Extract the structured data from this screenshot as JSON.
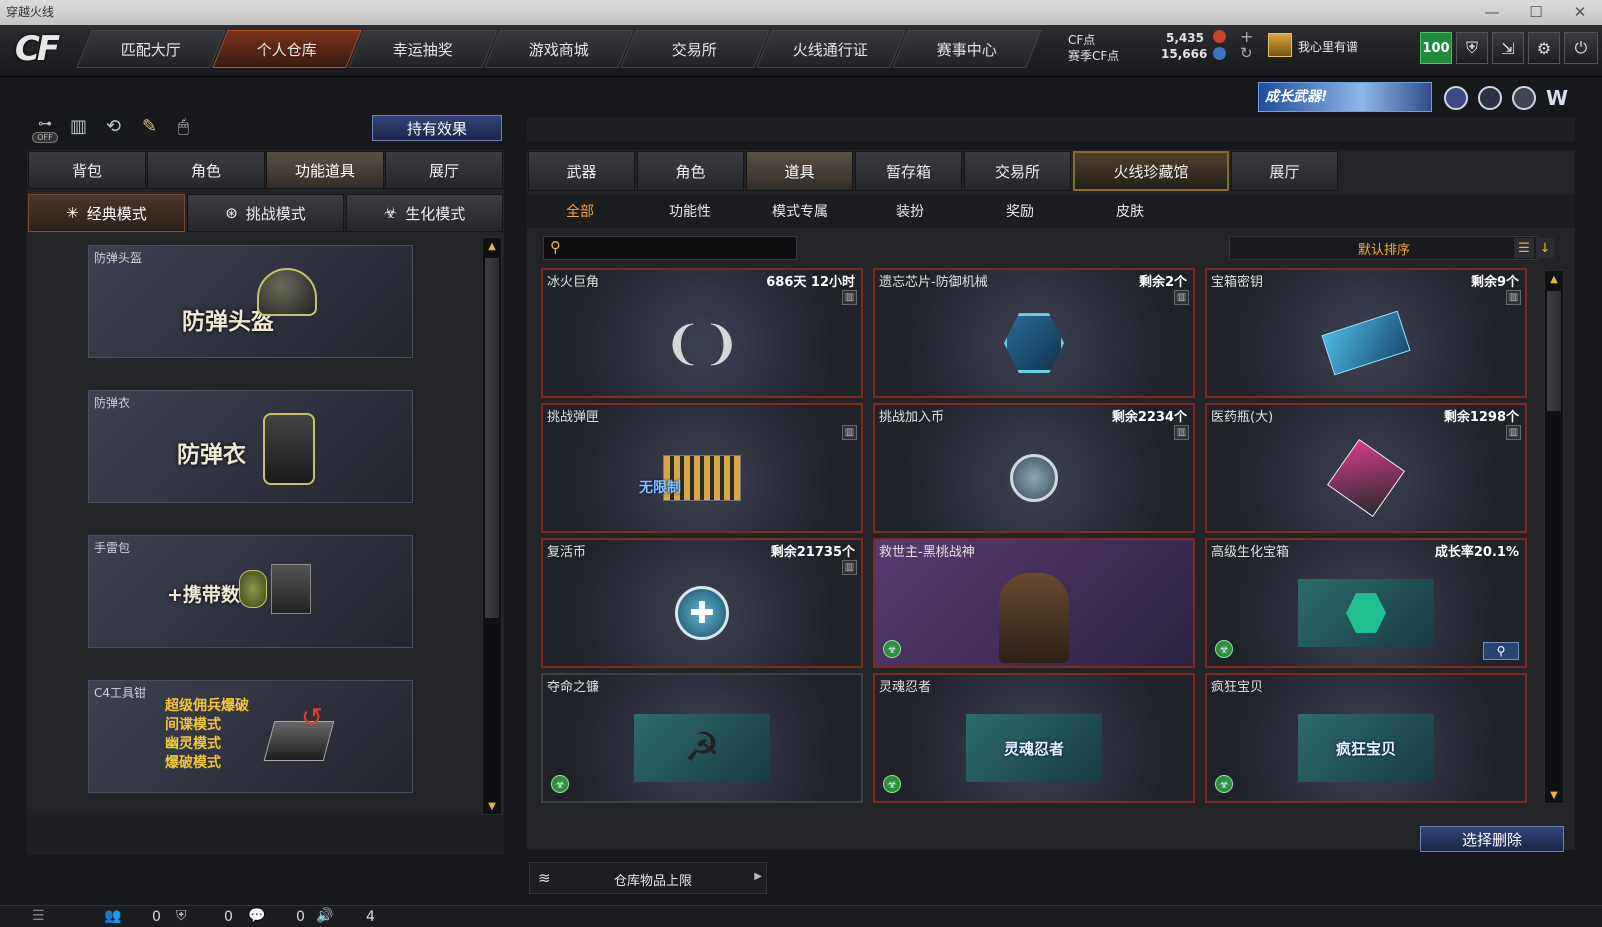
{
  "window": {
    "title": "穿越火线",
    "controls": [
      "—",
      "☐",
      "✕"
    ]
  },
  "logo": "CF",
  "nav": {
    "tabs": [
      "匹配大厅",
      "个人仓库",
      "幸运抽奖",
      "游戏商城",
      "交易所",
      "火线通行证",
      "赛事中心"
    ],
    "active": "个人仓库"
  },
  "currency": {
    "cf_label": "CF点",
    "cf_value": "5,435",
    "season_label": "赛季CF点",
    "season_value": "15,666",
    "plus": "+",
    "refresh": "↻"
  },
  "player": {
    "name": "我心里有谱",
    "level": "100"
  },
  "top_icons": [
    "shield-icon",
    "exit-icon",
    "gear-icon",
    "power-icon"
  ],
  "banner": {
    "text": "成长武器!",
    "icons": [
      "emblem-icon-1",
      "emblem-icon-2",
      "emblem-icon-3",
      "emblem-icon-4"
    ]
  },
  "left": {
    "toggle_off": "OFF",
    "effects_button": "持有效果",
    "tabs": [
      "背包",
      "角色",
      "功能道具",
      "展厅"
    ],
    "active_tab": "功能道具",
    "modes": [
      "经典模式",
      "挑战模式",
      "生化模式"
    ],
    "active_mode": "经典模式",
    "items": [
      {
        "caption": "防弹头盔",
        "big": "防弹头盔"
      },
      {
        "caption": "防弹衣",
        "big": "防弹衣"
      },
      {
        "caption": "手雷包",
        "big": "+携带数"
      },
      {
        "caption": "C4工具钳",
        "lines": [
          "超级佣兵爆破",
          "间谍模式",
          "幽灵模式",
          "爆破模式"
        ]
      }
    ]
  },
  "right": {
    "tabs": [
      "武器",
      "角色",
      "道具",
      "暂存箱",
      "交易所",
      "火线珍藏馆",
      "展厅"
    ],
    "active_tab": "道具",
    "highlight_tab": "火线珍藏馆",
    "filters": [
      "全部",
      "功能性",
      "模式专属",
      "装扮",
      "奖励",
      "皮肤"
    ],
    "active_filter": "全部",
    "search_placeholder": "",
    "sort_label": "默认排序",
    "cards": [
      {
        "name": "冰火巨角",
        "info": "686天 12小时",
        "trash": true,
        "badge": false,
        "img": "horns"
      },
      {
        "name": "遗忘芯片-防御机械",
        "info": "剩余2个",
        "trash": true,
        "badge": false,
        "img": "chip"
      },
      {
        "name": "宝箱密钥",
        "info": "剩余9个",
        "trash": true,
        "badge": false,
        "img": "key"
      },
      {
        "name": "挑战弹匣",
        "info": "",
        "trash": true,
        "badge": false,
        "img": "ammo",
        "overlay": "无限制"
      },
      {
        "name": "挑战加入币",
        "info": "剩余2234个",
        "trash": true,
        "badge": false,
        "img": "coin"
      },
      {
        "name": "医药瓶(大)",
        "info": "剩余1298个",
        "trash": true,
        "badge": false,
        "img": "medkit"
      },
      {
        "name": "复活币",
        "info": "剩余21735个",
        "trash": true,
        "badge": false,
        "img": "revive"
      },
      {
        "name": "救世主-黑桃战神",
        "info": "",
        "trash": false,
        "badge": true,
        "img": "soldier"
      },
      {
        "name": "高级生化宝箱",
        "info": "成长率20.1%",
        "trash": false,
        "badge": true,
        "img": "biobox",
        "search": true
      },
      {
        "name": "夺命之镰",
        "info": "",
        "trash": false,
        "badge": true,
        "img": "scythe"
      },
      {
        "name": "灵魂忍者",
        "info": "",
        "trash": false,
        "badge": true,
        "img": "ninja",
        "overlay": "灵魂忍者"
      },
      {
        "name": "疯狂宝贝",
        "info": "",
        "trash": false,
        "badge": true,
        "img": "baby",
        "overlay": "疯狂宝贝"
      }
    ],
    "delete_button": "选择删除",
    "capacity_label": "仓库物品上限"
  },
  "status": {
    "counts": [
      "0",
      "0",
      "0",
      "4"
    ]
  },
  "colors": {
    "active_nav": "#7a3219",
    "card_border": "#7a2c20",
    "badge": "#2f8d3d",
    "level": "#1e8c3a"
  }
}
